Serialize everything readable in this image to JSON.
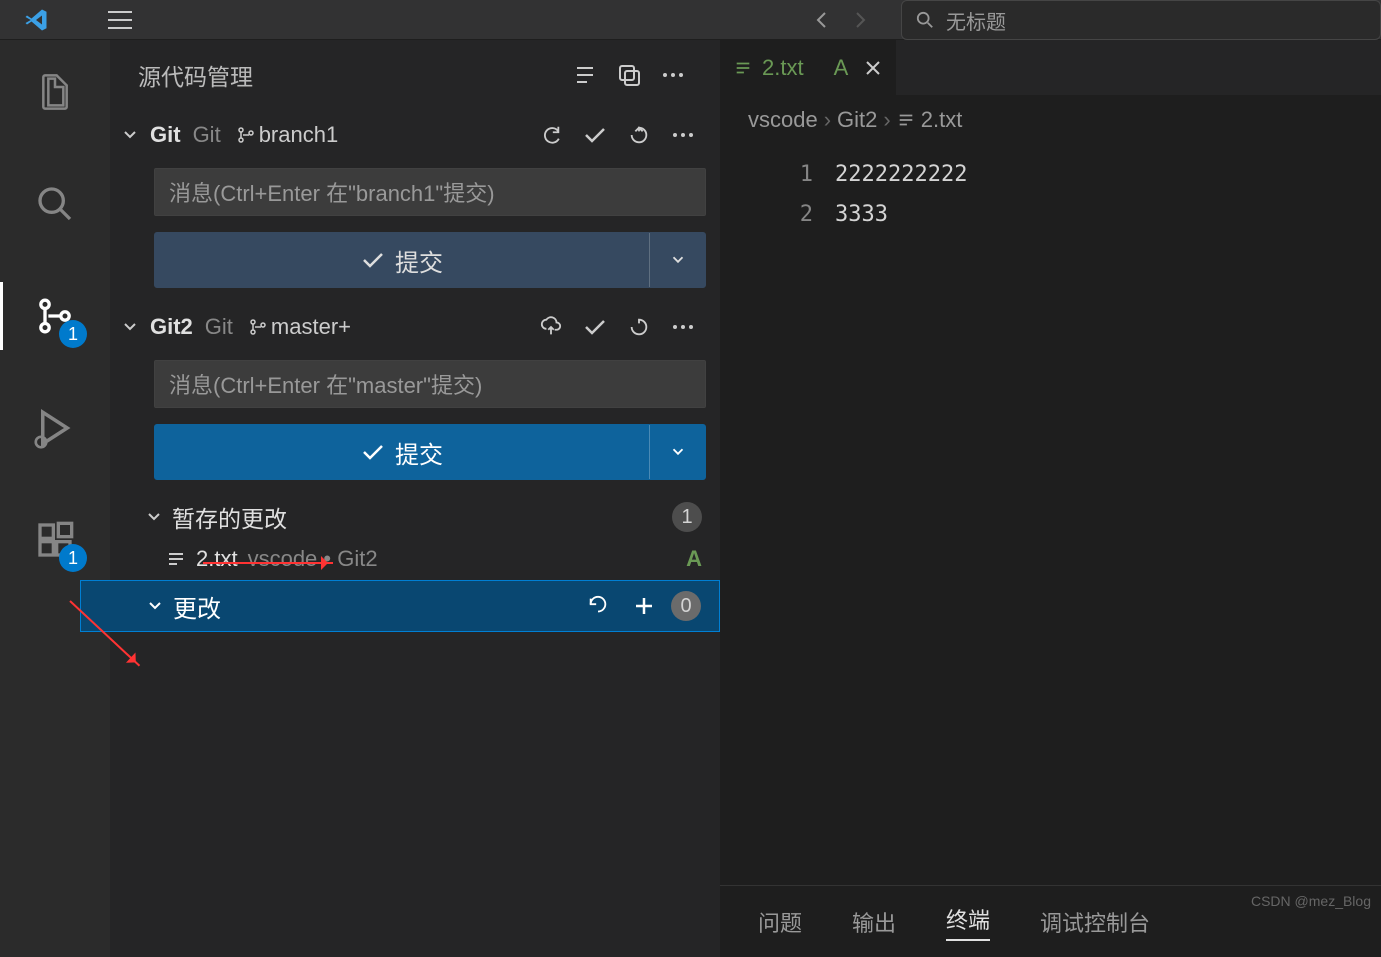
{
  "top": {
    "search_placeholder": "无标题"
  },
  "sidebar_title": "源代码管理",
  "activity_badges": {
    "scm": "1",
    "ext": "1"
  },
  "repos": [
    {
      "name": "Git",
      "type": "Git",
      "branch": "branch1",
      "input_placeholder": "消息(Ctrl+Enter 在\"branch1\"提交)",
      "commit_label": "提交"
    },
    {
      "name": "Git2",
      "type": "Git",
      "branch": "master+",
      "input_placeholder": "消息(Ctrl+Enter 在\"master\"提交)",
      "commit_label": "提交",
      "staged": {
        "title": "暂存的更改",
        "count": "1",
        "file": {
          "name": "2.txt",
          "path": "vscode • Git2",
          "status": "A"
        }
      },
      "changes": {
        "title": "更改",
        "count": "0"
      }
    }
  ],
  "editor": {
    "tab": {
      "name": "2.txt",
      "status": "A"
    },
    "breadcrumb": [
      "vscode",
      "Git2",
      "2.txt"
    ],
    "lines": [
      {
        "num": "1",
        "text": "2222222222"
      },
      {
        "num": "2",
        "text": "3333"
      }
    ]
  },
  "panel": {
    "tabs": [
      "问题",
      "输出",
      "终端",
      "调试控制台"
    ],
    "active": 2
  },
  "watermark": "CSDN @mez_Blog"
}
